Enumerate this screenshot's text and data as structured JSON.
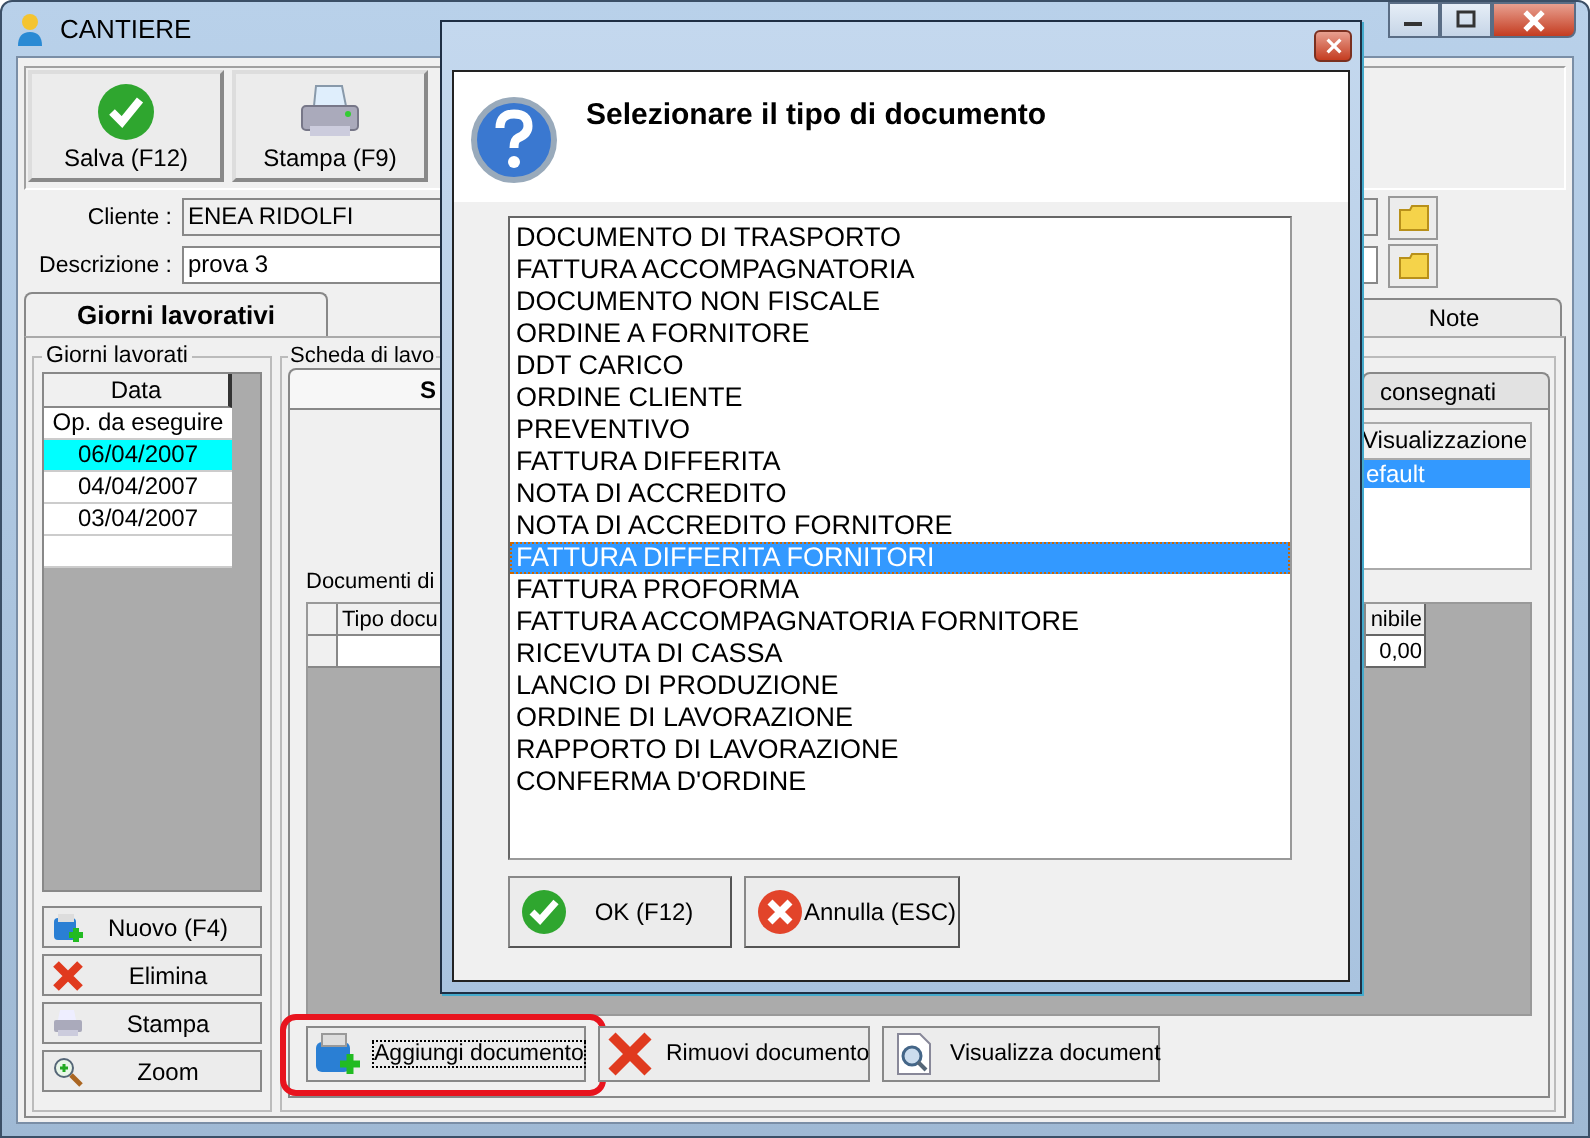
{
  "window": {
    "title": "CANTIERE"
  },
  "toolbar": [
    {
      "label": "Salva (F12)",
      "kind": "save"
    },
    {
      "label": "Stampa (F9)",
      "kind": "print"
    }
  ],
  "fields": [
    {
      "label": "Cliente :",
      "value": "ENEA RIDOLFI"
    },
    {
      "label": "Descrizione :",
      "value": "prova 3"
    }
  ],
  "tabs": [
    {
      "label": "Giorni lavorativi",
      "selected": true
    },
    {
      "label": "Note",
      "selected": false
    }
  ],
  "days_group": {
    "title": "Giorni lavorati",
    "column": "Data",
    "rows": [
      {
        "text": "Op. da eseguire",
        "selected": false
      },
      {
        "text": "06/04/2007",
        "selected": true
      },
      {
        "text": "04/04/2007",
        "selected": false
      },
      {
        "text": "03/04/2007",
        "selected": false
      }
    ],
    "buttons": [
      {
        "label": "Nuovo (F4)",
        "kind": "new"
      },
      {
        "label": "Elimina",
        "kind": "delete"
      },
      {
        "label": "Stampa",
        "kind": "print"
      },
      {
        "label": "Zoom",
        "kind": "zoom"
      }
    ]
  },
  "work_group": {
    "title": "Scheda di lavo",
    "tabs": [
      {
        "label": "S",
        "selected": true
      },
      {
        "label": "consegnati",
        "selected": false
      }
    ],
    "views": {
      "column": "Visualizzazione",
      "rows": [
        {
          "text": "efault",
          "selected": true
        }
      ]
    },
    "documents_label": "Documenti di",
    "documents_table": {
      "columns": [
        "Tipo docu",
        "nibile"
      ],
      "total": "0,00"
    },
    "buttons": [
      {
        "label": "Aggiungi documento",
        "kind": "add",
        "focused": true,
        "highlighted": true
      },
      {
        "label": "Rimuovi documento",
        "kind": "delete",
        "focused": false,
        "highlighted": false
      },
      {
        "label": "Visualizza document",
        "kind": "view",
        "focused": false,
        "highlighted": false
      }
    ]
  },
  "dialog": {
    "title": "Selezionare il tipo di documento",
    "items": [
      {
        "text": "DOCUMENTO DI TRASPORTO",
        "selected": false
      },
      {
        "text": "FATTURA ACCOMPAGNATORIA",
        "selected": false
      },
      {
        "text": "DOCUMENTO NON FISCALE",
        "selected": false
      },
      {
        "text": "ORDINE A FORNITORE",
        "selected": false
      },
      {
        "text": "DDT CARICO",
        "selected": false
      },
      {
        "text": "ORDINE CLIENTE",
        "selected": false
      },
      {
        "text": "PREVENTIVO",
        "selected": false
      },
      {
        "text": "FATTURA DIFFERITA",
        "selected": false
      },
      {
        "text": "NOTA DI ACCREDITO",
        "selected": false
      },
      {
        "text": "NOTA DI ACCREDITO FORNITORE",
        "selected": false
      },
      {
        "text": "FATTURA DIFFERITA FORNITORI",
        "selected": true
      },
      {
        "text": "FATTURA PROFORMA",
        "selected": false
      },
      {
        "text": "FATTURA ACCOMPAGNATORIA FORNITORE",
        "selected": false
      },
      {
        "text": "RICEVUTA DI CASSA",
        "selected": false
      },
      {
        "text": "LANCIO DI PRODUZIONE",
        "selected": false
      },
      {
        "text": "ORDINE DI LAVORAZIONE",
        "selected": false
      },
      {
        "text": "RAPPORTO DI LAVORAZIONE",
        "selected": false
      },
      {
        "text": "CONFERMA D'ORDINE",
        "selected": false
      }
    ],
    "buttons": [
      {
        "label": "OK (F12)",
        "kind": "ok"
      },
      {
        "label": "Annulla (ESC)",
        "kind": "cancel"
      }
    ]
  }
}
